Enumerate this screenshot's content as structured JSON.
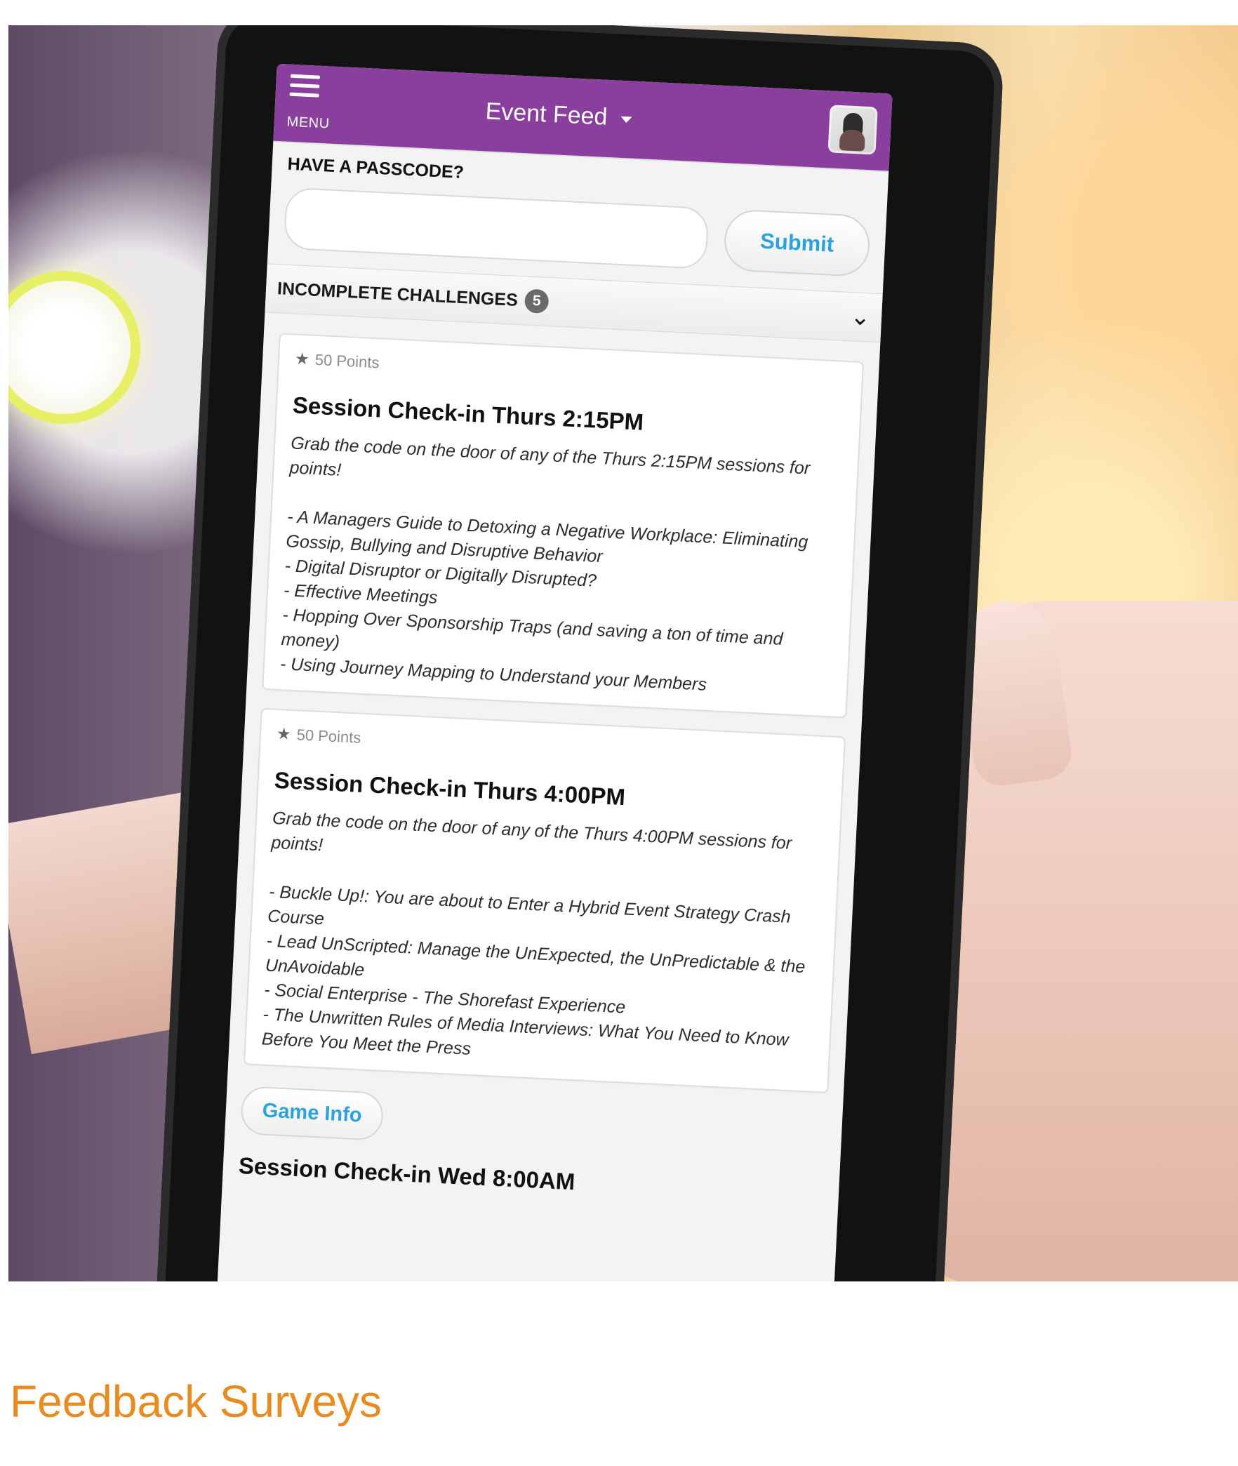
{
  "phone": {
    "topbar": {
      "menu_label": "MENU",
      "title": "Event Feed"
    },
    "passcode": {
      "label": "HAVE A PASSCODE?",
      "input_value": "",
      "submit_label": "Submit"
    },
    "challenges": {
      "header_label": "INCOMPLETE CHALLENGES",
      "count": "5"
    },
    "cards": [
      {
        "points": "50 Points",
        "title": "Session Check-in Thurs 2:15PM",
        "body": "Grab the code on the door of any of the Thurs 2:15PM sessions for points!\n\n- A Managers Guide to Detoxing a Negative Workplace: Eliminating Gossip, Bullying and Disruptive Behavior\n- Digital Disruptor or Digitally Disrupted?\n- Effective Meetings\n- Hopping Over Sponsorship Traps (and saving a ton of time and money)\n- Using Journey Mapping to Understand your Members"
      },
      {
        "points": "50 Points",
        "title": "Session Check-in Thurs 4:00PM",
        "body": "Grab the code on the door of any of the Thurs 4:00PM sessions for points!\n\n- Buckle Up!: You are about to Enter a Hybrid Event Strategy Crash Course\n- Lead UnScripted: Manage the UnExpected, the UnPredictable & the UnAvoidable\n- Social Enterprise - The Shorefast Experience\n- The Unwritten Rules of Media Interviews: What You Need to Know Before You Meet the Press"
      }
    ],
    "game_info_label": "Game Info",
    "next_card_title": "Session Check-in Wed 8:00AM"
  },
  "caption": "Feedback Surveys",
  "colors": {
    "topbar": "#8a3e9e",
    "accent_link": "#2aa2dd",
    "caption": "#e98b1f"
  },
  "icons": {
    "menu": "menu-icon",
    "caret": "caret-down-icon",
    "star": "star-icon",
    "chevron": "chevron-down-icon",
    "avatar": "avatar"
  }
}
